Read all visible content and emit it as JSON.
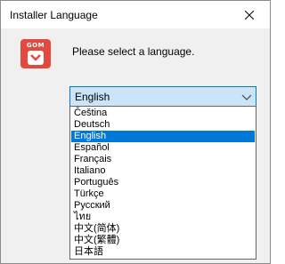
{
  "window": {
    "title": "Installer Language"
  },
  "app_icon": {
    "brand": "GOM",
    "color": "#e4493f"
  },
  "dialog": {
    "prompt": "Please select a language."
  },
  "language_select": {
    "selected": "English",
    "options": [
      "Čeština",
      "Deutsch",
      "English",
      "Español",
      "Français",
      "Italiano",
      "Português",
      "Türkçe",
      "Русский",
      "ไทย",
      "中文(简体)",
      "中文(繁體)",
      "日本語"
    ],
    "highlighted_index": 2
  },
  "colors": {
    "accent": "#0078d7",
    "combo_bg": "#cce4f7",
    "dialog_bg": "#f0f0f0"
  }
}
